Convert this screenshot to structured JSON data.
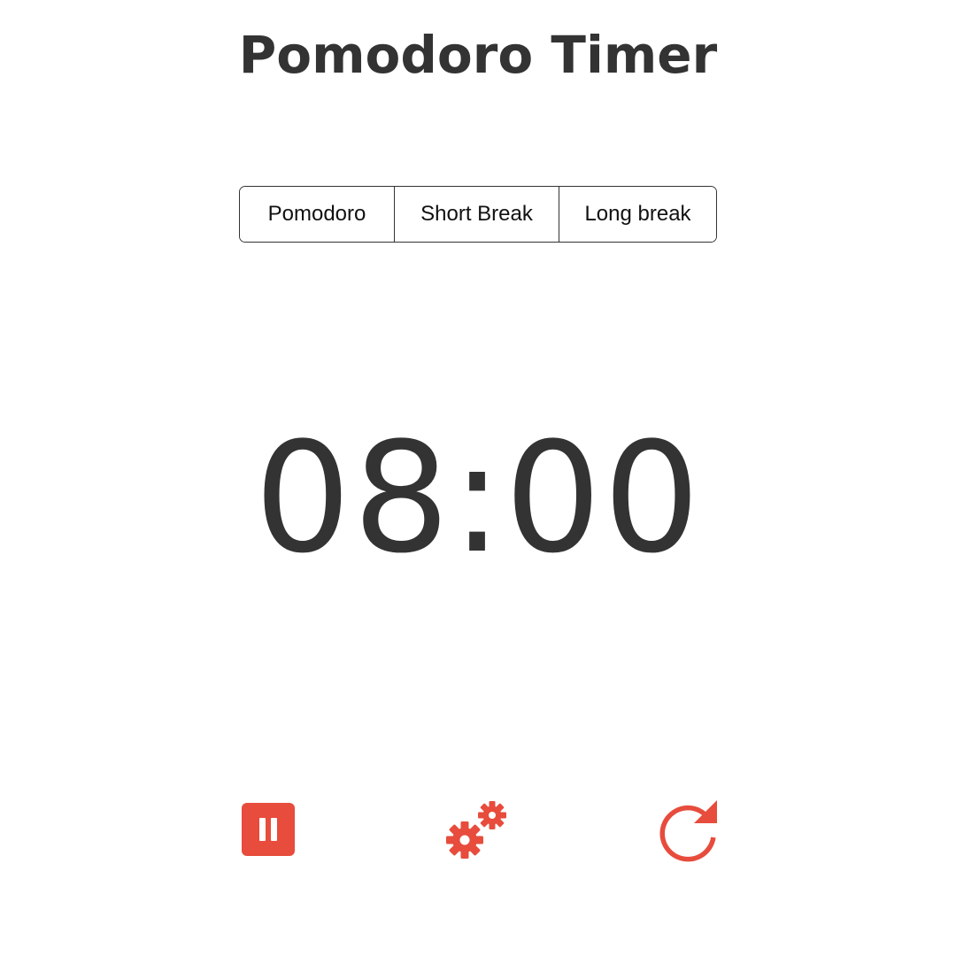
{
  "app": {
    "title": "Pomodoro Timer"
  },
  "modes": [
    {
      "label": "Pomodoro"
    },
    {
      "label": "Short Break"
    },
    {
      "label": "Long break"
    }
  ],
  "timer": {
    "display": "08:00"
  },
  "controls": {
    "pause_icon": "pause-icon",
    "settings_icon": "gears-icon",
    "reset_icon": "reset-icon"
  },
  "colors": {
    "accent": "#e74c3c",
    "text": "#333333",
    "background": "#ffffff"
  }
}
